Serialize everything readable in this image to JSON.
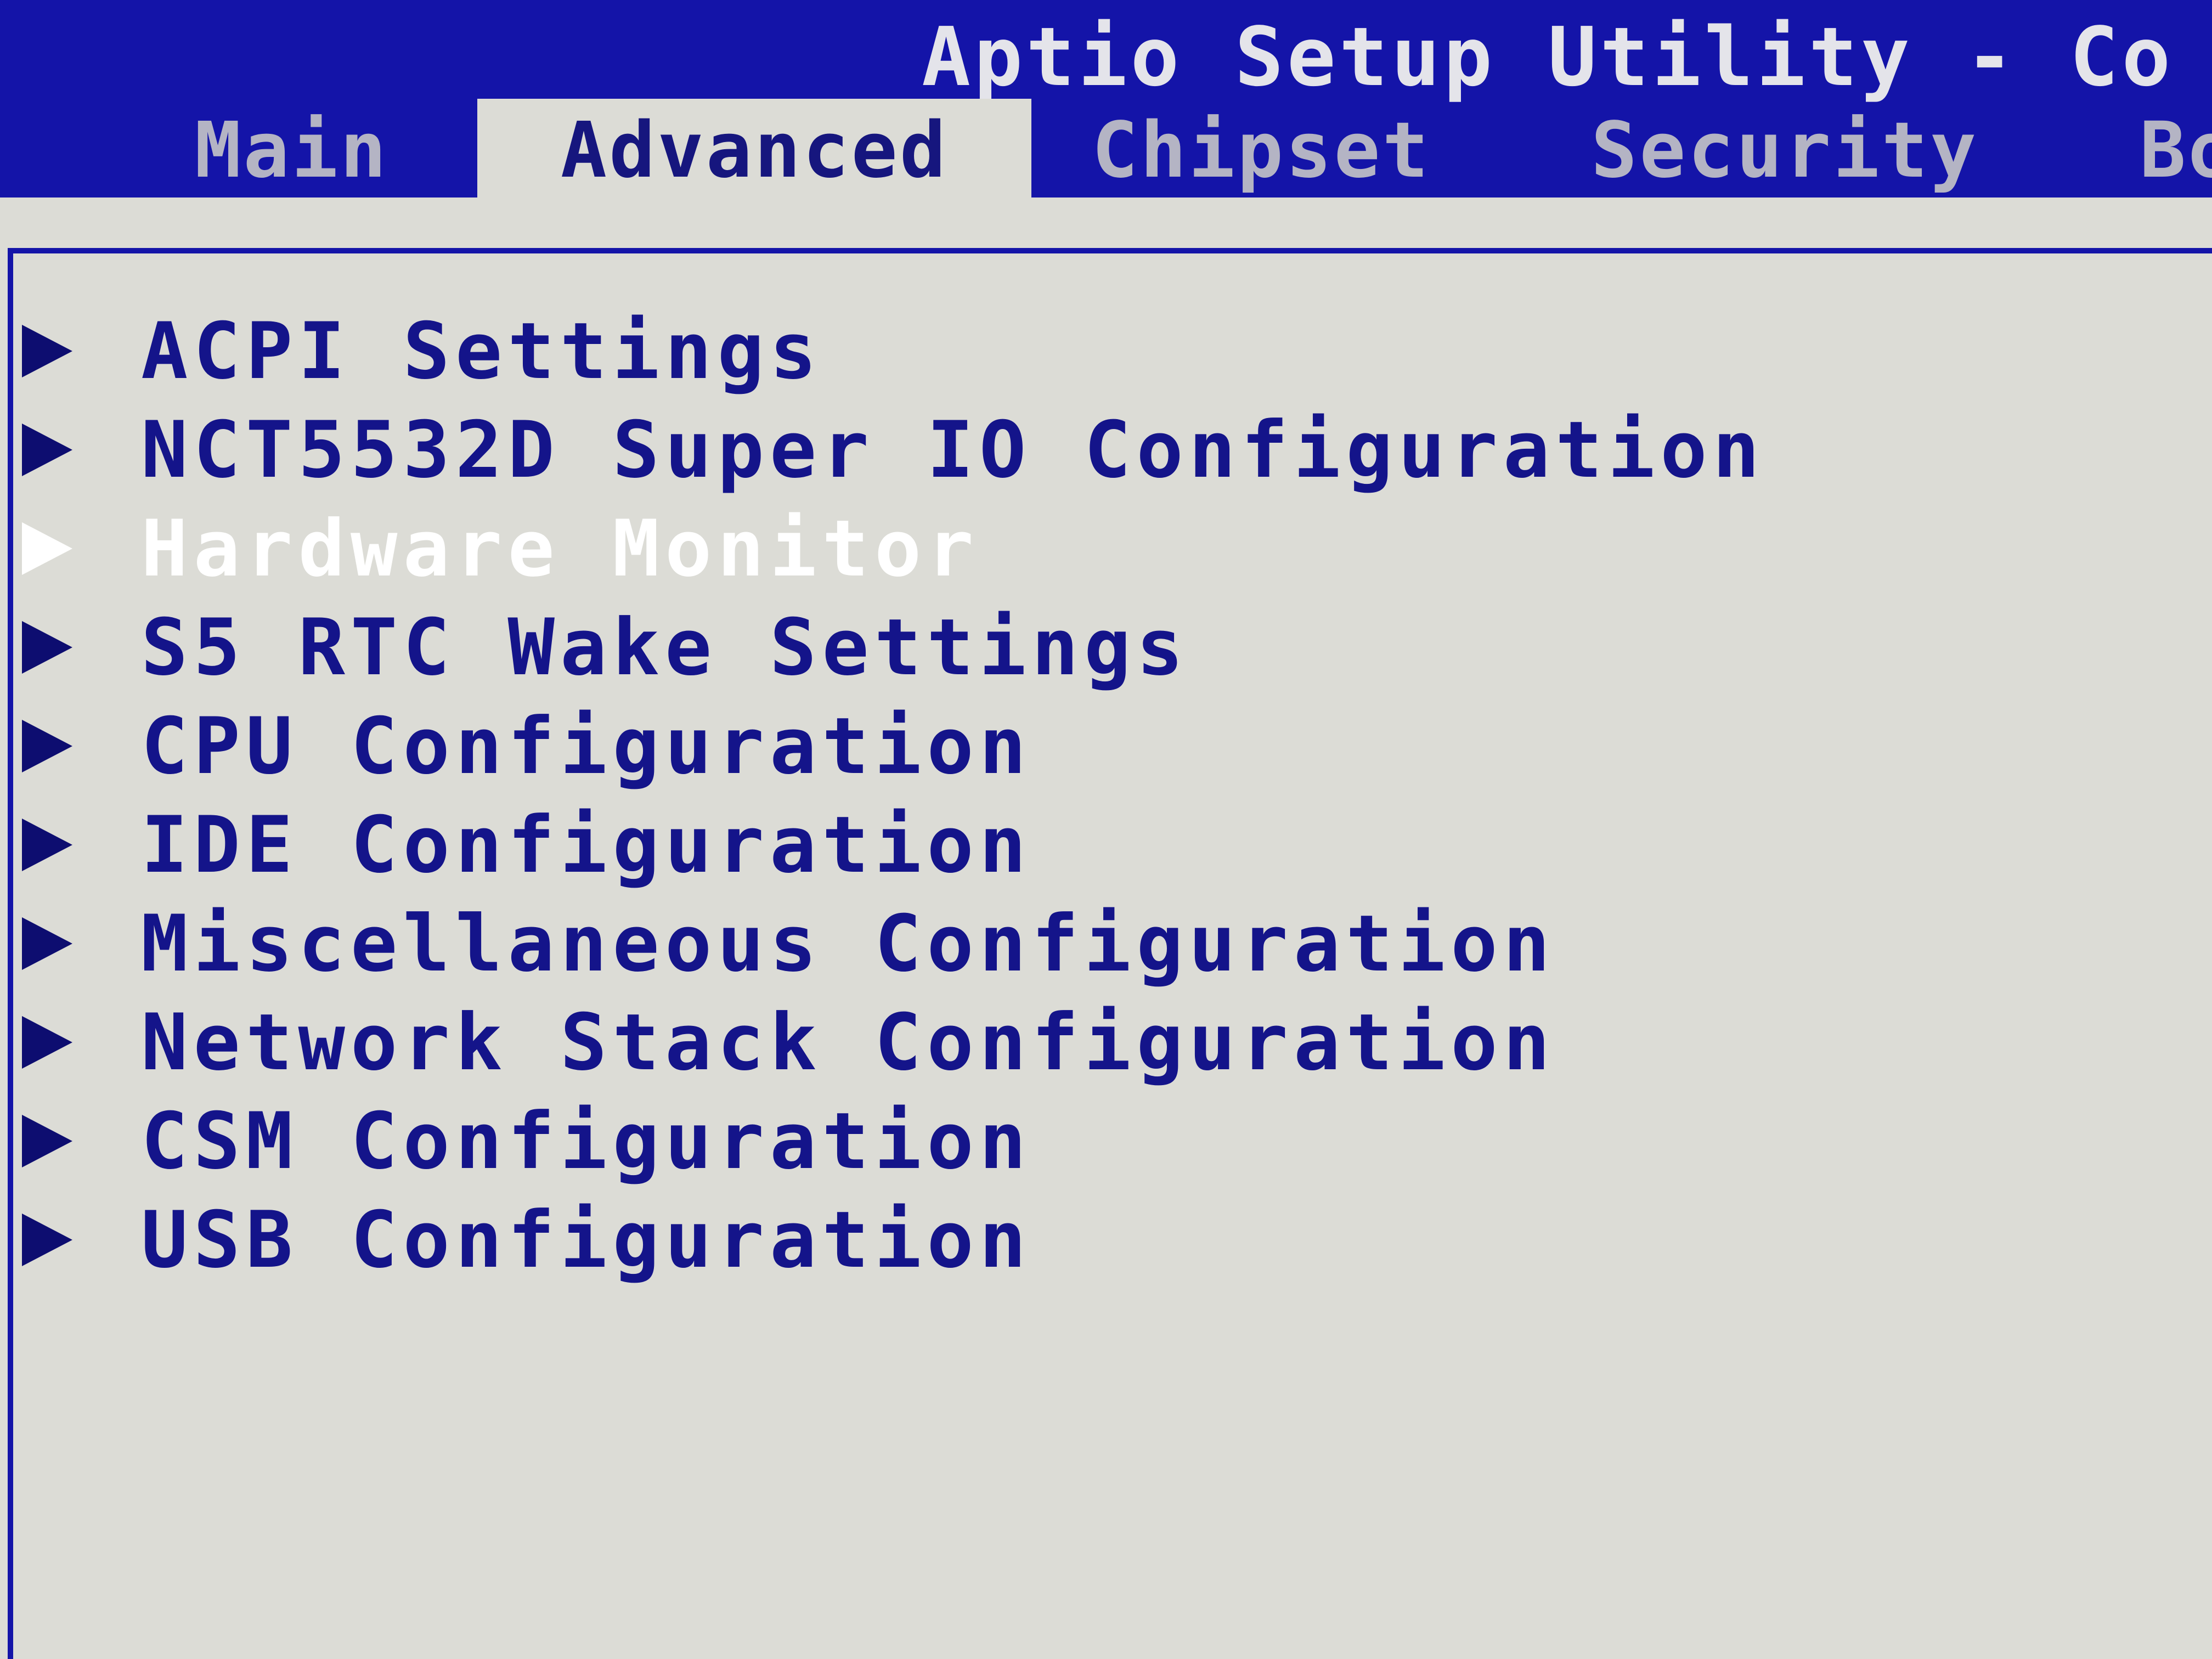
{
  "header": {
    "title": "Aptio Setup Utility - Co"
  },
  "tabs": [
    {
      "label": "Main"
    },
    {
      "label": "Advanced"
    },
    {
      "label": "Chipset"
    },
    {
      "label": "Security"
    },
    {
      "label": "Bo"
    }
  ],
  "active_tab": "Advanced",
  "menu": {
    "items": [
      {
        "label": "ACPI Settings"
      },
      {
        "label": "NCT5532D Super IO Configuration"
      },
      {
        "label": "Hardware Monitor"
      },
      {
        "label": "S5 RTC Wake Settings"
      },
      {
        "label": "CPU Configuration"
      },
      {
        "label": "IDE Configuration"
      },
      {
        "label": "Miscellaneous Configuration"
      },
      {
        "label": "Network Stack Configuration"
      },
      {
        "label": "CSM Configuration"
      },
      {
        "label": "USB Configuration"
      }
    ],
    "selected_label": "Hardware Monitor"
  },
  "colors": {
    "bar_blue": "#1414a8",
    "panel_grey": "#dcdcd6",
    "text_navy": "#14148a",
    "selected_text": "#ffffff",
    "inactive_tab_text": "#b4b4c4"
  }
}
